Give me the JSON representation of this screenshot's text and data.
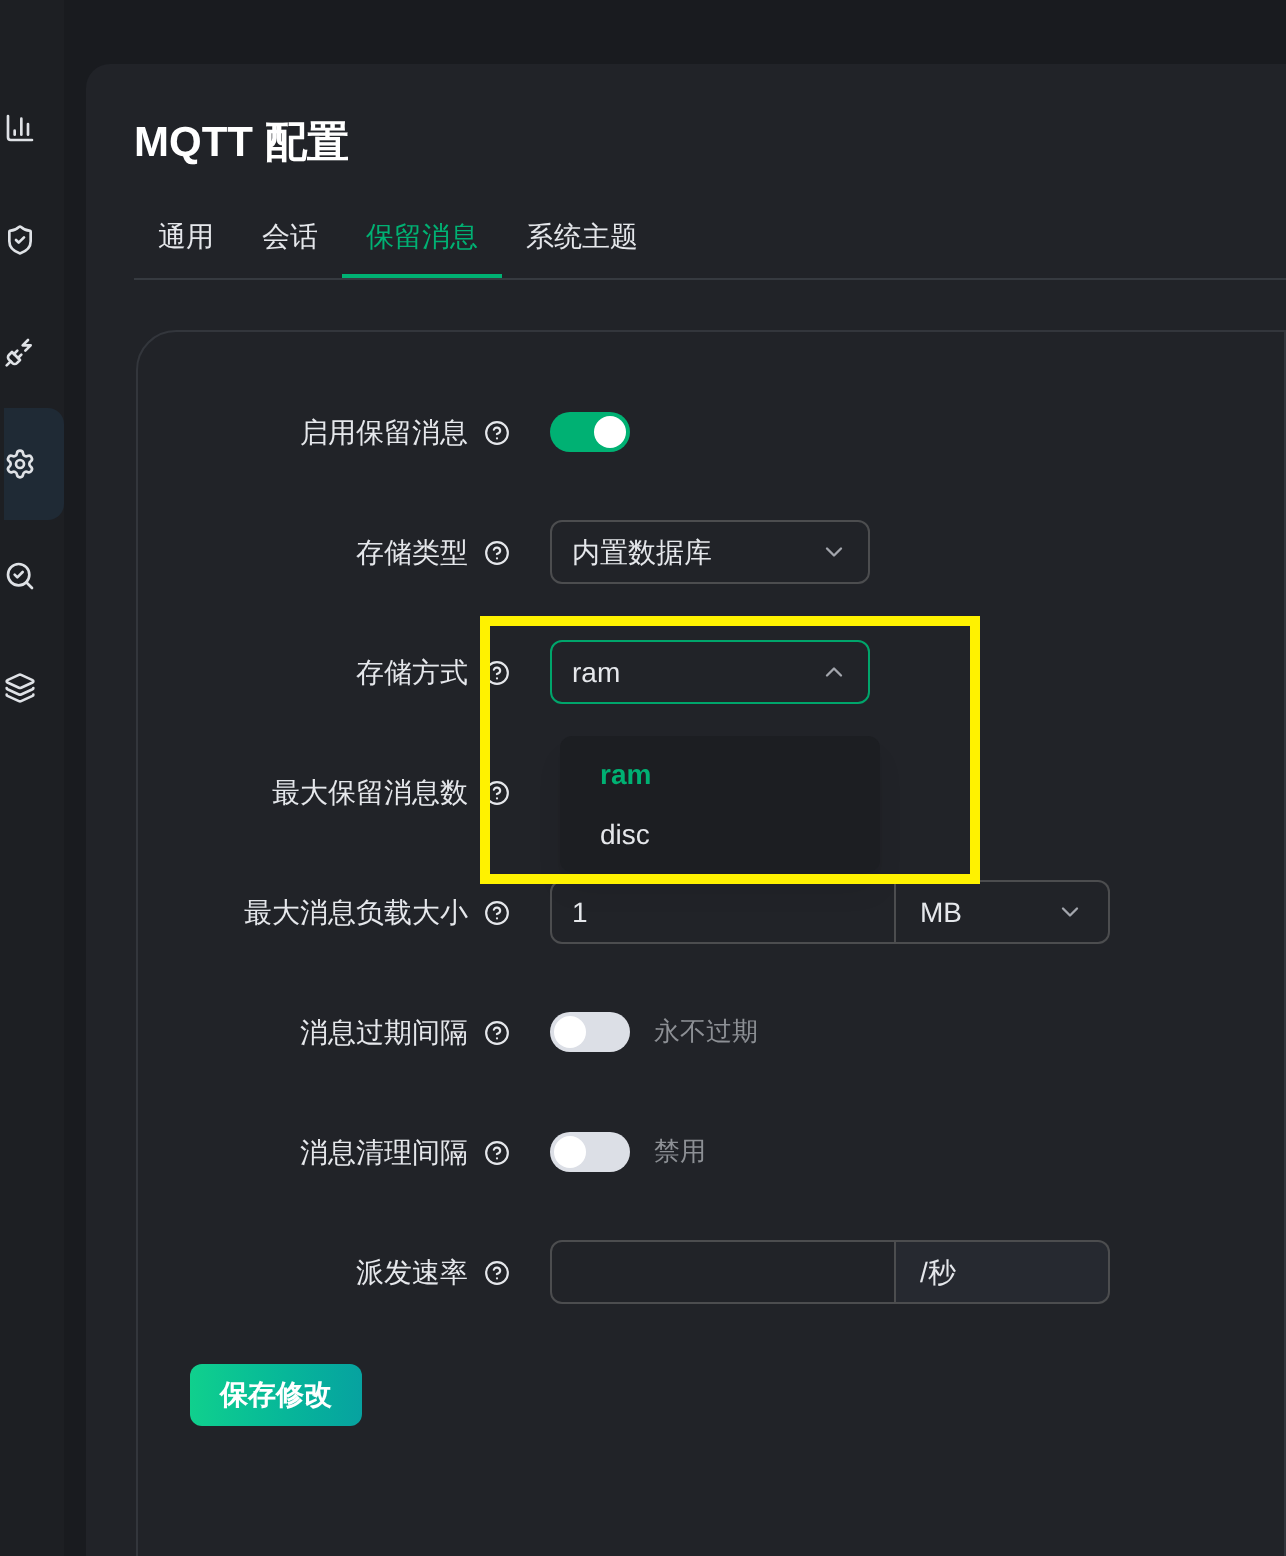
{
  "sidebar": {
    "items": [
      {
        "kind": "chart",
        "selected": false
      },
      {
        "kind": "shield",
        "selected": false
      },
      {
        "kind": "plug",
        "selected": false
      },
      {
        "kind": "settings",
        "selected": true
      },
      {
        "kind": "search",
        "selected": false
      },
      {
        "kind": "layers",
        "selected": false
      }
    ]
  },
  "title": "MQTT 配置",
  "tabs": [
    {
      "label": "通用",
      "selected": false
    },
    {
      "label": "会话",
      "selected": false
    },
    {
      "label": "保留消息",
      "selected": true
    },
    {
      "label": "系统主题",
      "selected": false
    }
  ],
  "form": [
    {
      "label": "启用保留消息",
      "kind": "switch",
      "on": true
    },
    {
      "label": "存储类型",
      "kind": "select",
      "value": "内置数据库",
      "expanded": false
    },
    {
      "label": "存储方式",
      "kind": "select",
      "value": "ram",
      "expanded": true,
      "options": [
        {
          "label": "ram",
          "selected": true
        },
        {
          "label": "disc",
          "selected": false
        }
      ]
    },
    {
      "label": "最大保留消息数",
      "kind": "hidden"
    },
    {
      "label": "最大消息负载大小",
      "kind": "unit-select",
      "value": "1",
      "unit": "MB"
    },
    {
      "label": "消息过期间隔",
      "kind": "switch",
      "on": false,
      "note": "永不过期"
    },
    {
      "label": "消息清理间隔",
      "kind": "switch",
      "on": false,
      "note": "禁用"
    },
    {
      "label": "派发速率",
      "kind": "unit-input",
      "unit": "/秒"
    }
  ],
  "save_button": "保存修改"
}
